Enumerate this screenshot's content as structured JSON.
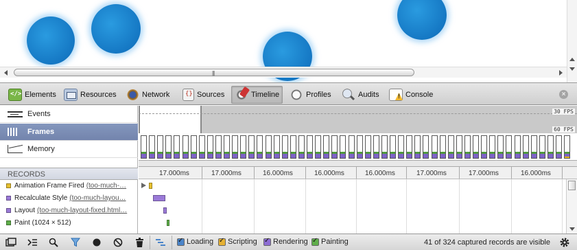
{
  "toolbar": {
    "tabs": [
      {
        "label": "Elements",
        "icon": "elements-icon"
      },
      {
        "label": "Resources",
        "icon": "resources-icon"
      },
      {
        "label": "Network",
        "icon": "network-icon"
      },
      {
        "label": "Sources",
        "icon": "sources-icon"
      },
      {
        "label": "Timeline",
        "icon": "timeline-icon",
        "active": true
      },
      {
        "label": "Profiles",
        "icon": "profiles-icon"
      },
      {
        "label": "Audits",
        "icon": "audits-icon"
      },
      {
        "label": "Console",
        "icon": "console-icon"
      }
    ],
    "close_glyph": "×"
  },
  "overview": {
    "items": [
      {
        "label": "Events",
        "icon": "events-icon"
      },
      {
        "label": "Frames",
        "icon": "frames-icon",
        "selected": true
      },
      {
        "label": "Memory",
        "icon": "memory-icon"
      }
    ],
    "fps_30": "30 FPS",
    "fps_60": "60 FPS"
  },
  "records": {
    "header": "RECORDS",
    "items": [
      {
        "label": "Animation Frame Fired",
        "link": "(too-much-…",
        "color": "#e6c030"
      },
      {
        "label": "Recalculate Style",
        "link": "(too-much-layou…",
        "color": "#9b7ad8"
      },
      {
        "label": "Layout",
        "link": "(too-much-layout-fixed.html…",
        "color": "#9b7ad8"
      },
      {
        "label": "Paint (1024 × 512)",
        "link": "",
        "color": "#5fae4a"
      }
    ]
  },
  "ruler": {
    "labels": [
      "17.000ms",
      "17.000ms",
      "16.000ms",
      "16.000ms",
      "16.000ms",
      "17.000ms",
      "17.000ms",
      "16.000ms"
    ]
  },
  "statusbar": {
    "categories": [
      {
        "label": "Loading",
        "color": "#4a84c9"
      },
      {
        "label": "Scripting",
        "color": "#e6b133"
      },
      {
        "label": "Rendering",
        "color": "#8d6dd4"
      },
      {
        "label": "Painting",
        "color": "#5fae4a"
      }
    ],
    "status": "41 of 324 captured records are visible"
  },
  "colors": {
    "rendering": "#7d63c7",
    "painting": "#4f9a3c",
    "scripting": "#e6b800",
    "selected_item": "#7384ad"
  }
}
